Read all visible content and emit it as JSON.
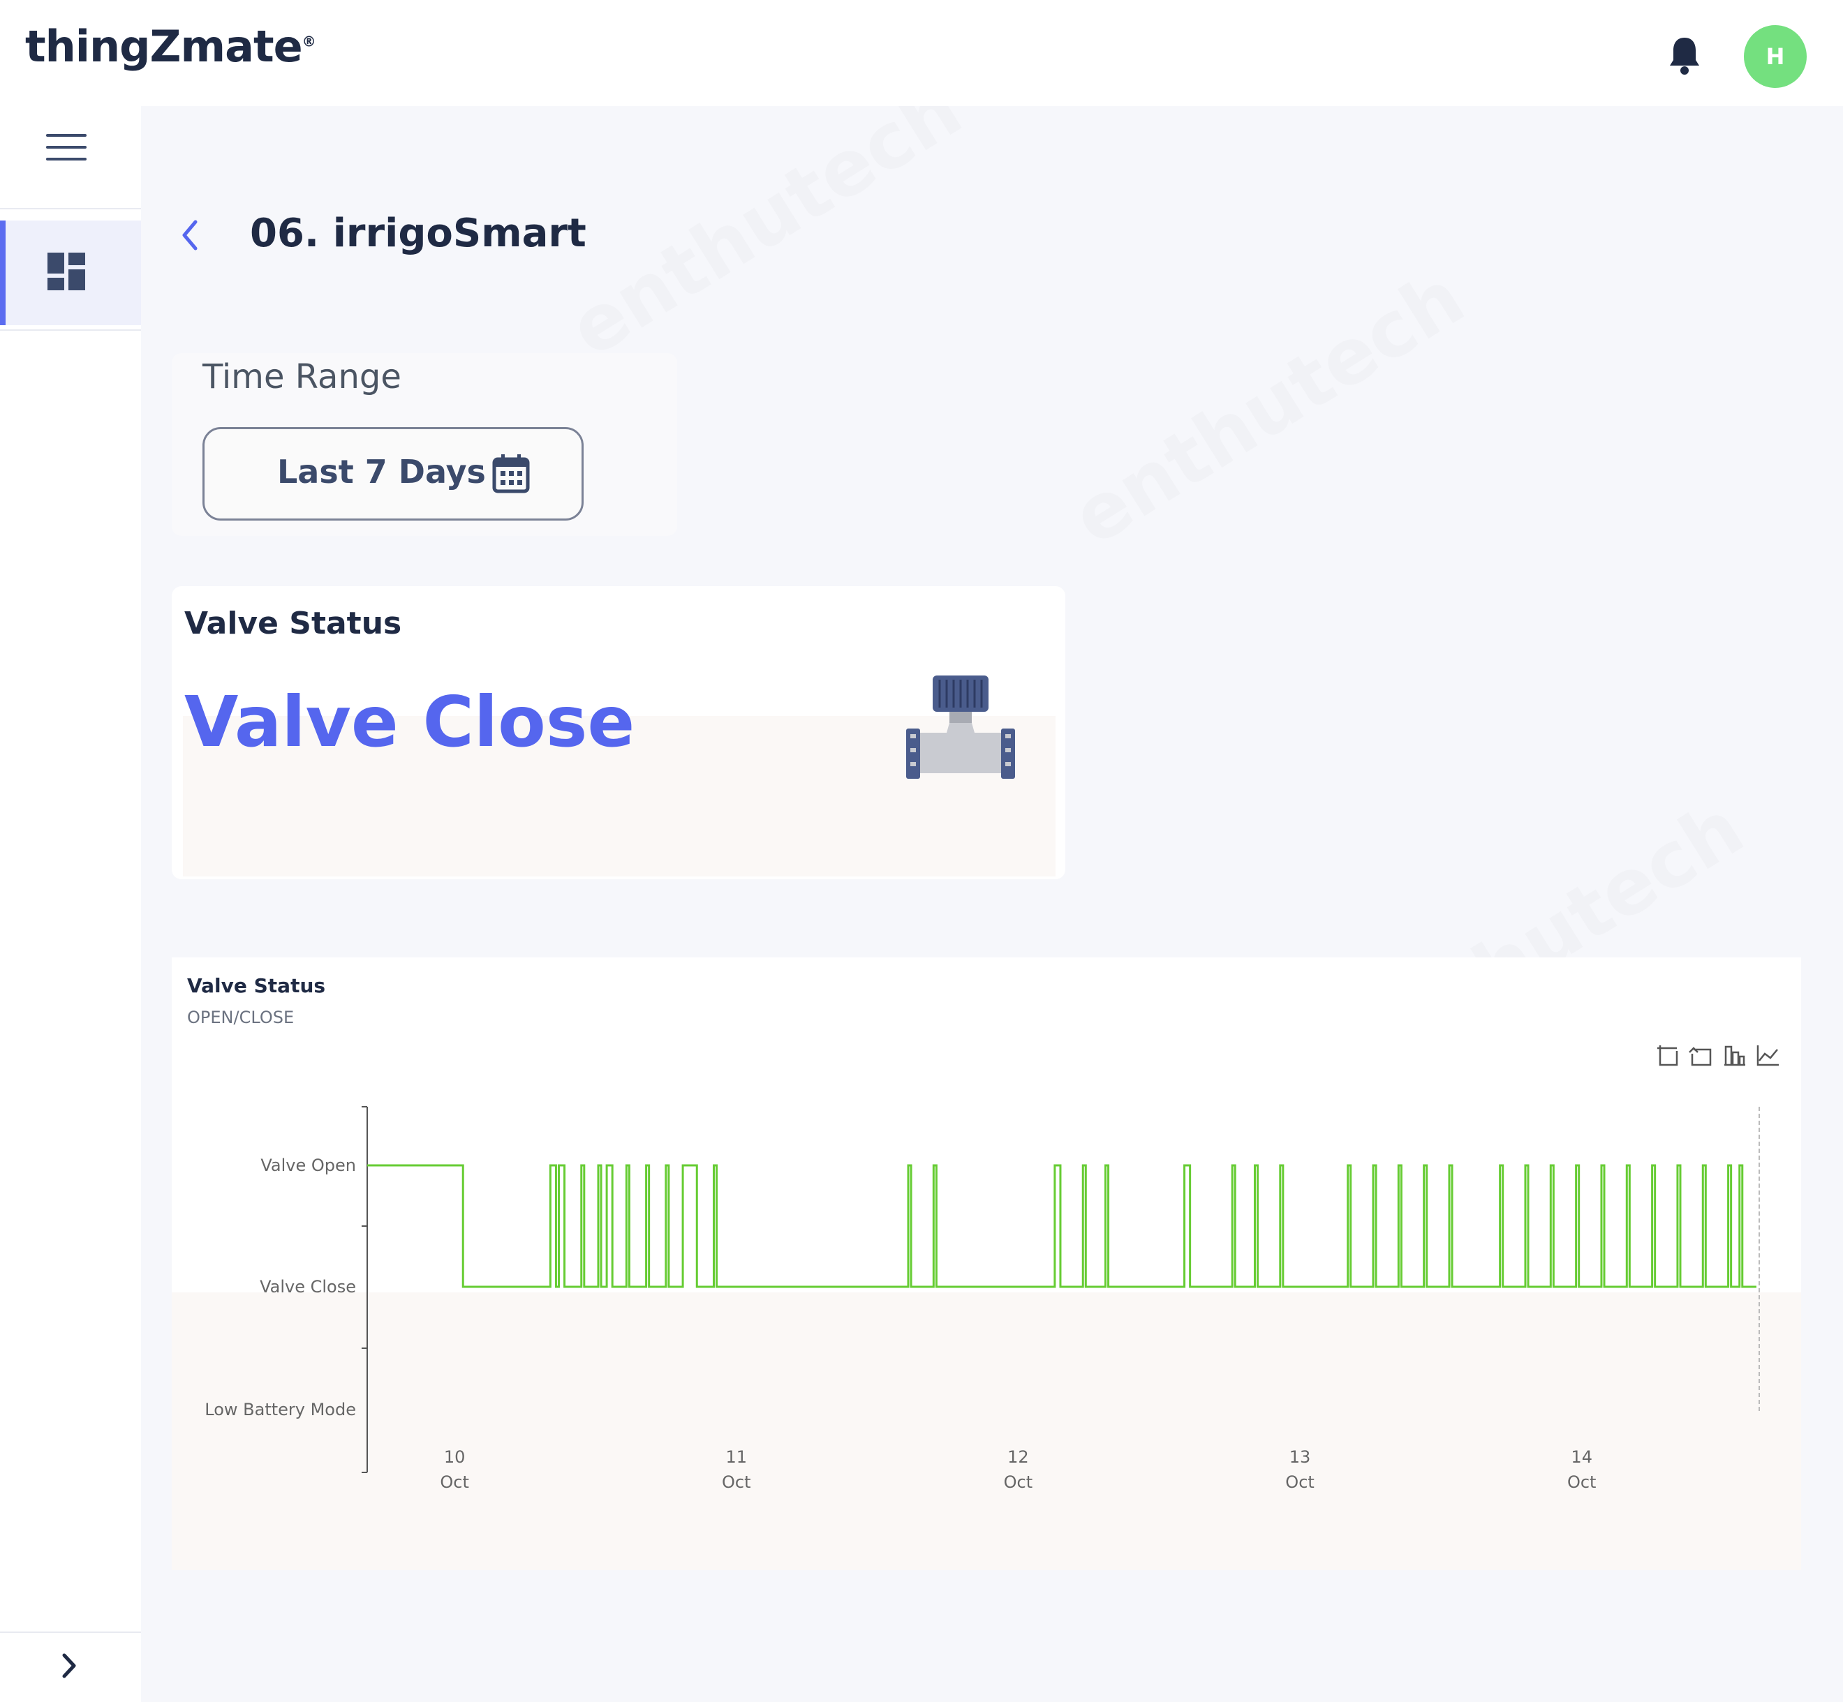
{
  "header": {
    "logo_text": "thingZmate",
    "logo_mark": "®",
    "avatar_initial": "H"
  },
  "page": {
    "title": "06. irrigoSmart"
  },
  "time_range": {
    "label": "Time Range",
    "value": "Last 7 Days"
  },
  "valve_status_card": {
    "title": "Valve Status",
    "value": "Valve Close",
    "accent_color": "#5566ee"
  },
  "chart_card": {
    "title": "Valve Status",
    "subtitle": "OPEN/CLOSE"
  },
  "watermark": "enthutech",
  "colors": {
    "series": "#66cc33",
    "avatar": "#74e07f",
    "sidebar_active": "#5b6cf0"
  },
  "chart_data": {
    "type": "line",
    "title": "Valve Status",
    "subtitle": "OPEN/CLOSE",
    "y_categories": [
      "Low Battery Mode",
      "Valve Close",
      "Valve Open"
    ],
    "x_ticks": [
      {
        "day": "10",
        "month": "Oct",
        "value": 10
      },
      {
        "day": "11",
        "month": "Oct",
        "value": 11
      },
      {
        "day": "12",
        "month": "Oct",
        "value": 12
      },
      {
        "day": "13",
        "month": "Oct",
        "value": 13
      },
      {
        "day": "14",
        "month": "Oct",
        "value": 14
      }
    ],
    "x_range": [
      9.69,
      14.63
    ],
    "series": [
      {
        "open_intervals": [
          [
            9.69,
            10.03
          ],
          [
            10.34,
            10.36
          ],
          [
            10.37,
            10.39
          ],
          [
            10.45,
            10.46
          ],
          [
            10.51,
            10.52
          ],
          [
            10.54,
            10.56
          ],
          [
            10.61,
            10.62
          ],
          [
            10.68,
            10.69
          ],
          [
            10.75,
            10.76
          ],
          [
            10.81,
            10.86
          ],
          [
            10.92,
            10.93
          ],
          [
            11.61,
            11.62
          ],
          [
            11.7,
            11.71
          ],
          [
            12.13,
            12.15
          ],
          [
            12.23,
            12.24
          ],
          [
            12.31,
            12.32
          ],
          [
            12.59,
            12.61
          ],
          [
            12.76,
            12.77
          ],
          [
            12.84,
            12.85
          ],
          [
            12.93,
            12.94
          ],
          [
            13.17,
            13.18
          ],
          [
            13.26,
            13.27
          ],
          [
            13.35,
            13.36
          ],
          [
            13.44,
            13.45
          ],
          [
            13.53,
            13.54
          ],
          [
            13.71,
            13.72
          ],
          [
            13.8,
            13.81
          ],
          [
            13.89,
            13.9
          ],
          [
            13.98,
            13.99
          ],
          [
            14.07,
            14.08
          ],
          [
            14.16,
            14.17
          ],
          [
            14.25,
            14.26
          ],
          [
            14.34,
            14.35
          ],
          [
            14.43,
            14.44
          ],
          [
            14.52,
            14.53
          ],
          [
            14.56,
            14.57
          ]
        ]
      }
    ],
    "x_end": 14.62,
    "toolbox": [
      "zoom-icon",
      "zoom-reset-icon",
      "bar-chart-icon",
      "line-chart-icon"
    ]
  }
}
